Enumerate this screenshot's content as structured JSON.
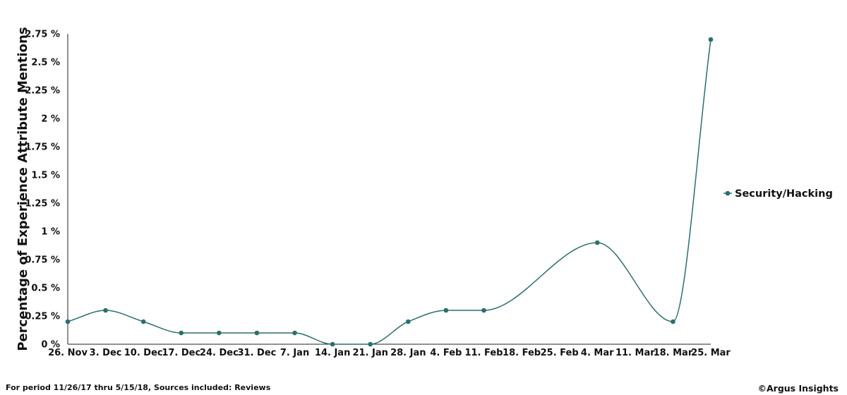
{
  "footer": {
    "period_text": "For period 11/26/17 thru 5/15/18, Sources included: Reviews",
    "copyright": "©Argus Insights"
  },
  "colors": {
    "series": "#2a6f6f",
    "axis": "#222222"
  },
  "chart_data": {
    "type": "line",
    "ylabel": "Percentage of Experience Attribute Mentions",
    "xlabel": "",
    "categories": [
      "26. Nov",
      "3. Dec",
      "10. Dec",
      "17. Dec",
      "24. Dec",
      "31. Dec",
      "7. Jan",
      "14. Jan",
      "21. Jan",
      "28. Jan",
      "4. Feb",
      "11. Feb",
      "18. Feb",
      "25. Feb",
      "4. Mar",
      "11. Mar",
      "18. Mar",
      "25. Mar"
    ],
    "ylim": [
      0,
      2.75
    ],
    "yticks": [
      0,
      0.25,
      0.5,
      0.75,
      1,
      1.25,
      1.5,
      1.75,
      2,
      2.25,
      2.5,
      2.75
    ],
    "ytick_labels": [
      "0 %",
      "0.25 %",
      "0.5 %",
      "0.75 %",
      "1 %",
      "1.25 %",
      "1.5 %",
      "1.75 %",
      "2 %",
      "2.25 %",
      "2.5 %",
      "2.75 %"
    ],
    "series": [
      {
        "name": "Security/Hacking",
        "points": [
          {
            "x": "26. Nov",
            "y": 0.2
          },
          {
            "x": "3. Dec",
            "y": 0.3
          },
          {
            "x": "10. Dec",
            "y": 0.2
          },
          {
            "x": "17. Dec",
            "y": 0.1
          },
          {
            "x": "24. Dec",
            "y": 0.1
          },
          {
            "x": "31. Dec",
            "y": 0.1
          },
          {
            "x": "7. Jan",
            "y": 0.1
          },
          {
            "x": "14. Jan",
            "y": 0
          },
          {
            "x": "21. Jan",
            "y": 0
          },
          {
            "x": "28. Jan",
            "y": 0.2
          },
          {
            "x": "4. Feb",
            "y": 0.3
          },
          {
            "x": "11. Feb",
            "y": 0.3
          },
          {
            "x": "4. Mar",
            "y": 0.9
          },
          {
            "x": "18. Mar",
            "y": 0.2
          },
          {
            "x": "25. Mar",
            "y": 2.7
          }
        ]
      }
    ],
    "grid": false,
    "legend": "right"
  }
}
